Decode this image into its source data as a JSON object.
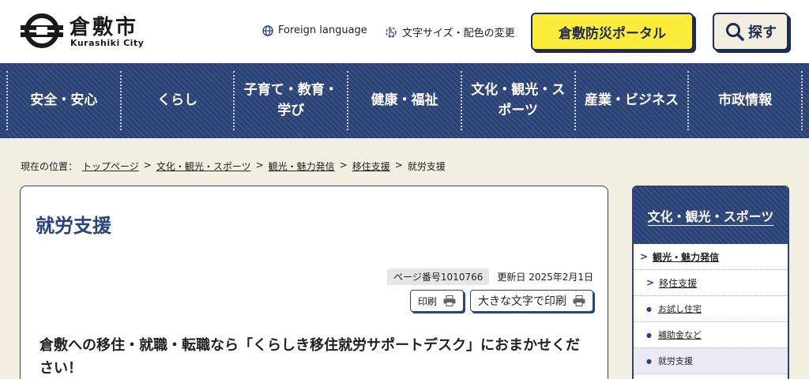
{
  "header": {
    "logo_text": "倉敷市",
    "logo_sub": "Kurashiki City",
    "foreign_language": "Foreign language",
    "text_size_color": "文字サイズ・配色の変更",
    "bousai_portal": "倉敷防災ポータル",
    "search": "探す"
  },
  "nav": [
    {
      "label": "安全・安心"
    },
    {
      "label": "くらし"
    },
    {
      "label": "子育て・教育・学び"
    },
    {
      "label": "健康・福祉"
    },
    {
      "label": "文化・観光・スポーツ"
    },
    {
      "label": "産業・ビジネス"
    },
    {
      "label": "市政情報"
    }
  ],
  "breadcrumb": {
    "prefix": "現在の位置：",
    "items": [
      "トップページ",
      "文化・観光・スポーツ",
      "観光・魅力発信",
      "移住支援",
      "就労支援"
    ],
    "separator": ">"
  },
  "main": {
    "title": "就労支援",
    "page_number": "ページ番号1010766",
    "updated": "更新日 2025年2月1日",
    "print": "印刷",
    "print_large": "大きな文字で印刷",
    "lead": "倉敷への移住・就職・転職なら「くらしき移住就労サポートデスク」におまかせください！"
  },
  "side": {
    "heading": "文化・観光・スポーツ",
    "items": [
      {
        "label": "観光・魅力発信"
      },
      {
        "label": "移住支援"
      },
      {
        "label": "お試し住宅"
      },
      {
        "label": "補助金など"
      },
      {
        "label": "就労支援"
      }
    ]
  },
  "colors": {
    "navy": "#2b447a",
    "yellow": "#fdec3a",
    "cream": "#f3efe0"
  }
}
